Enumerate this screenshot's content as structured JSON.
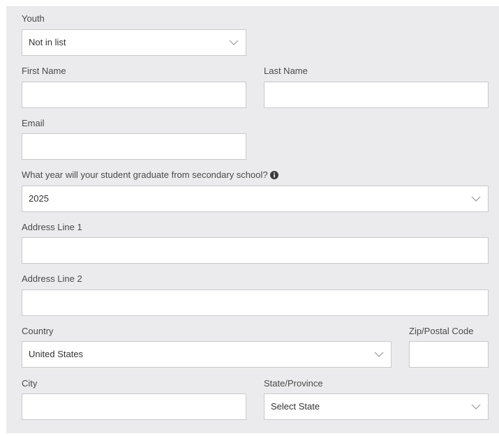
{
  "form": {
    "youth": {
      "label": "Youth",
      "value": "Not in list"
    },
    "first_name": {
      "label": "First Name",
      "value": ""
    },
    "last_name": {
      "label": "Last Name",
      "value": ""
    },
    "email": {
      "label": "Email",
      "value": ""
    },
    "graduation_year": {
      "label": "What year will your student graduate from secondary school?",
      "value": "2025",
      "icon": "info-icon"
    },
    "address_line1": {
      "label": "Address Line 1",
      "value": ""
    },
    "address_line2": {
      "label": "Address Line 2",
      "value": ""
    },
    "country": {
      "label": "Country",
      "value": "United States"
    },
    "zip": {
      "label": "Zip/Postal Code",
      "value": ""
    },
    "city": {
      "label": "City",
      "value": ""
    },
    "state": {
      "label": "State/Province",
      "value": "Select State"
    }
  },
  "colors": {
    "panel_background": "#ebebed",
    "field_background": "#ffffff",
    "field_border": "#c9c9cc",
    "label_text": "#4a4a4a"
  }
}
